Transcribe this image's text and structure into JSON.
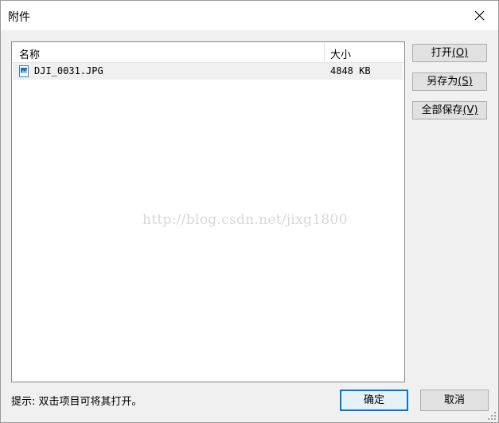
{
  "window": {
    "title": "附件"
  },
  "list": {
    "columns": {
      "name": "名称",
      "size": "大小"
    },
    "rows": [
      {
        "name": "DJI_0031.JPG",
        "size": "4848 KB",
        "icon": "image-file-icon"
      }
    ]
  },
  "watermark": "http://blog.csdn.net/jixg1800",
  "side_buttons": {
    "open": {
      "label": "打开",
      "mnemonic": "(O)"
    },
    "save_as": {
      "label": "另存为",
      "mnemonic": "(S)"
    },
    "save_all": {
      "label": "全部保存",
      "mnemonic": "(V)"
    }
  },
  "footer": {
    "hint": "提示: 双击项目可将其打开。",
    "ok_label": "确定",
    "cancel_label": "取消"
  },
  "colors": {
    "accent": "#0078d7",
    "selected_row": "#f0f0f0"
  }
}
